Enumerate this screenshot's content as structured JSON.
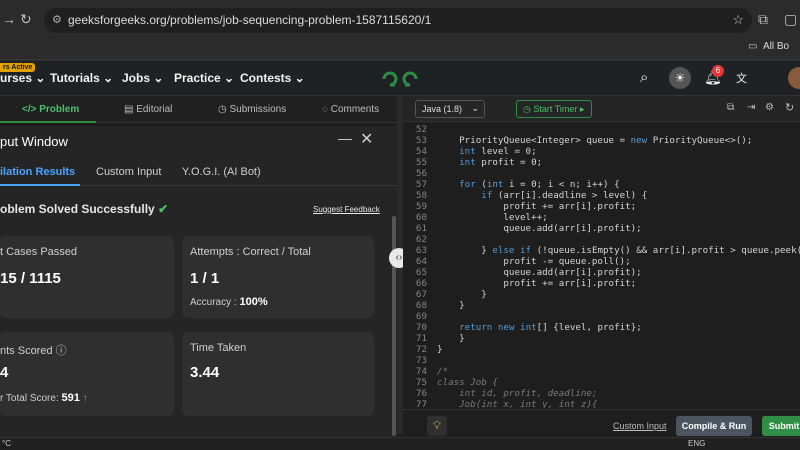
{
  "browser": {
    "url": "geeksforgeeks.org/problems/job-sequencing-problem-1587115620/1",
    "bookmarks_label": "All Bo"
  },
  "nav": {
    "badge": "rs Active",
    "items": [
      "urses",
      "Tutorials",
      "Jobs",
      "Practice",
      "Contests"
    ],
    "notification_count": "6"
  },
  "left_tabs": [
    "</> Problem",
    "Editorial",
    "Submissions",
    "Comments"
  ],
  "output_window": {
    "title": "put Window",
    "tabs": [
      "ilation Results",
      "Custom Input",
      "Y.O.G.I. (AI Bot)"
    ],
    "status": "oblem Solved Successfully",
    "suggest_feedback": "Suggest Feedback",
    "cards": {
      "test_cases_title": "t Cases Passed",
      "test_cases_value": "15 / 1115",
      "attempts_title": "Attempts : Correct / Total",
      "attempts_value": "1 / 1",
      "accuracy_label": "Accuracy :",
      "accuracy_value": "100%",
      "points_title": "nts Scored",
      "points_value": "4",
      "total_label": "r Total Score:",
      "total_value": "591",
      "time_title": "Time Taken",
      "time_value": "3.44"
    }
  },
  "editor": {
    "language": "Java (1.8)",
    "timer": "Start Timer",
    "lines": [
      {
        "n": "52",
        "t": ""
      },
      {
        "n": "53",
        "t": "    PriorityQueue<Integer> queue = new PriorityQueue<>();"
      },
      {
        "n": "54",
        "t": "    int level = 0;"
      },
      {
        "n": "55",
        "t": "    int profit = 0;"
      },
      {
        "n": "56",
        "t": ""
      },
      {
        "n": "57",
        "t": "    for (int i = 0; i < n; i++) {"
      },
      {
        "n": "58",
        "t": "        if (arr[i].deadline > level) {"
      },
      {
        "n": "59",
        "t": "            profit += arr[i].profit;"
      },
      {
        "n": "60",
        "t": "            level++;"
      },
      {
        "n": "61",
        "t": "            queue.add(arr[i].profit);"
      },
      {
        "n": "62",
        "t": ""
      },
      {
        "n": "63",
        "t": "        } else if (!queue.isEmpty() && arr[i].profit > queue.peek())"
      },
      {
        "n": "64",
        "t": "            profit -= queue.poll();"
      },
      {
        "n": "65",
        "t": "            queue.add(arr[i].profit);"
      },
      {
        "n": "66",
        "t": "            profit += arr[i].profit;"
      },
      {
        "n": "67",
        "t": "        }"
      },
      {
        "n": "68",
        "t": "    }"
      },
      {
        "n": "69",
        "t": ""
      },
      {
        "n": "70",
        "t": "    return new int[] {level, profit};"
      },
      {
        "n": "71",
        "t": "    }"
      },
      {
        "n": "72",
        "t": "}"
      },
      {
        "n": "73",
        "t": ""
      },
      {
        "n": "74",
        "t": "/*"
      },
      {
        "n": "75",
        "t": "class Job {"
      },
      {
        "n": "76",
        "t": "    int id, profit, deadline;"
      },
      {
        "n": "77",
        "t": "    Job(int x, int y, int z){"
      }
    ],
    "custom_input": "Custom Input",
    "compile_run": "Compile & Run",
    "submit": "Submit"
  },
  "taskbar": {
    "left": "°C",
    "lang": "ENG"
  },
  "colors": {
    "brand_green": "#2f8d46",
    "success_green": "#4cc06b",
    "link_blue": "#4aa3ff"
  }
}
